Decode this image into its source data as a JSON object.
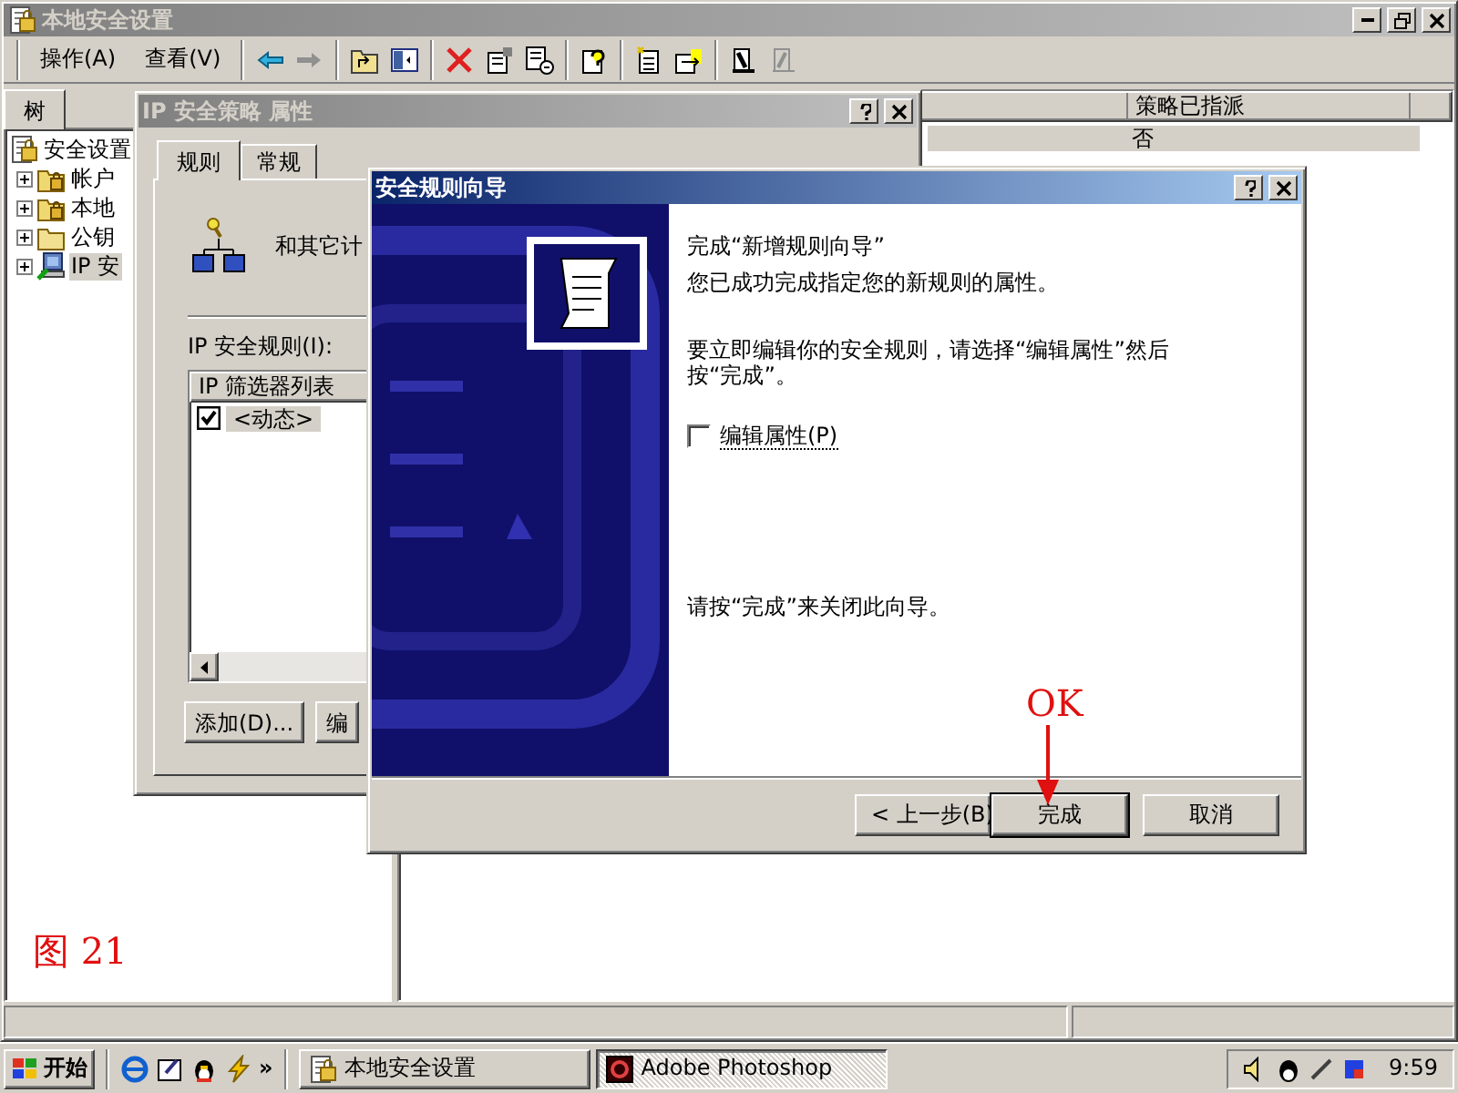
{
  "main_window": {
    "title": "本地安全设置",
    "active": false,
    "menu": [
      "操作(A)",
      "查看(V)"
    ],
    "tree_tab": "树",
    "tree": [
      {
        "label": "安全设置",
        "kind": "lock",
        "selected": false,
        "children": [
          {
            "label": "帐户",
            "kind": "lock-folder",
            "expanded": false,
            "selected": false
          },
          {
            "label": "本地",
            "kind": "lock-folder",
            "expanded": false,
            "selected": false
          },
          {
            "label": "公钥",
            "kind": "folder",
            "expanded": false,
            "selected": false
          },
          {
            "label": "IP 安",
            "kind": "computer",
            "expanded": false,
            "selected": true
          }
        ]
      }
    ],
    "columns": [
      "策略已指派"
    ],
    "rows": [
      {
        "cells": [
          "否"
        ],
        "selected": true
      }
    ]
  },
  "properties_dialog": {
    "title": "IP 安全策略 属性",
    "active": false,
    "tabs": [
      {
        "label": "规则",
        "selected": true
      },
      {
        "label": "常规",
        "selected": false
      }
    ],
    "description": "和其它计",
    "rules_label": "IP 安全规则(I):",
    "rules_columns": [
      "IP 筛选器列表"
    ],
    "rules": [
      {
        "label": "<动态>",
        "checked": true,
        "selected": true
      }
    ],
    "buttons": [
      "添加(D)...",
      "编"
    ]
  },
  "wizard": {
    "title": "安全规则向导",
    "active": true,
    "heading": "完成“新增规则向导”",
    "text": "您已成功完成指定您的新规则的属性。",
    "instruction": "要立即编辑你的安全规则，请选择“编辑属性”然后按“完成”。",
    "option": {
      "label": "编辑属性(P)",
      "checked": false
    },
    "footer": "请按“完成”来关闭此向导。",
    "buttons": [
      {
        "label": "< 上一步(B)",
        "default": false
      },
      {
        "label": "完成",
        "default": true
      },
      {
        "label": "取消",
        "default": false
      }
    ]
  },
  "annotations": [
    {
      "kind": "caption",
      "text": "图 21"
    },
    {
      "kind": "arrow-label",
      "text": "OK"
    }
  ],
  "taskbar": {
    "start": "开始",
    "overflow": "»",
    "tasks": [
      {
        "label": "本地安全设置",
        "selected": false
      },
      {
        "label": "Adobe Photoshop",
        "selected": true
      }
    ],
    "clock": "9:59"
  }
}
